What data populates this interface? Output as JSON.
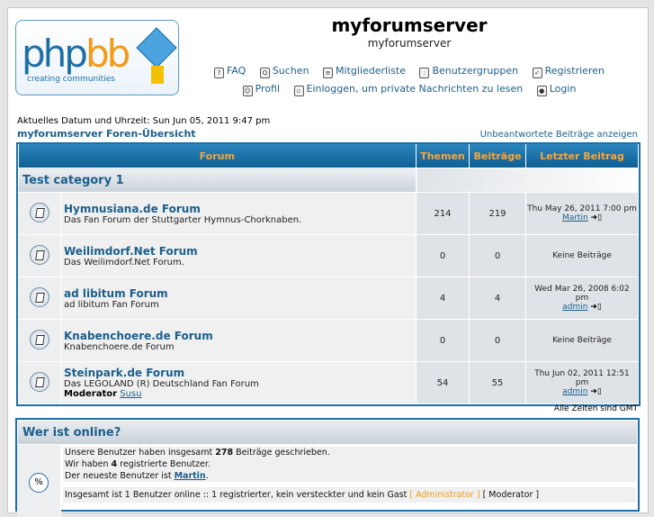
{
  "header": {
    "site_title": "myforumserver",
    "site_desc": "myforumserver",
    "logo_text": "phpbb creating communities"
  },
  "nav": {
    "row1": [
      {
        "label": "FAQ",
        "icon": "faq-icon"
      },
      {
        "label": "Suchen",
        "icon": "search-icon"
      },
      {
        "label": "Mitgliederliste",
        "icon": "memberlist-icon"
      },
      {
        "label": "Benutzergruppen",
        "icon": "groups-icon"
      },
      {
        "label": "Registrieren",
        "icon": "register-icon"
      }
    ],
    "row2": [
      {
        "label": "Profil",
        "icon": "profile-icon"
      },
      {
        "label": "Einloggen, um private Nachrichten zu lesen",
        "icon": "message-icon"
      },
      {
        "label": "Login",
        "icon": "login-icon"
      }
    ]
  },
  "date_line": "Aktuelles Datum und Uhrzeit: Sun Jun 05, 2011 9:47 pm",
  "breadcrumb": "myforumserver Foren-Übersicht",
  "unanswered_link": "Unbeantwortete Beiträge anzeigen",
  "table": {
    "headers": {
      "forum": "Forum",
      "topics": "Themen",
      "posts": "Beiträge",
      "last": "Letzter Beitrag"
    },
    "category": "Test category 1",
    "forums": [
      {
        "name": "Hymnusiana.de Forum",
        "desc": "Das Fan Forum der Stuttgarter Hymnus-Chorknaben.",
        "topics": "214",
        "posts": "219",
        "last_date": "Thu May 26, 2011 7:00 pm",
        "last_user": "Martin"
      },
      {
        "name": "Weilimdorf.Net Forum",
        "desc": "Das Weilimdorf.Net Forum.",
        "topics": "0",
        "posts": "0",
        "no_posts": "Keine Beiträge"
      },
      {
        "name": "ad libitum Forum",
        "desc": "ad libitum Fan Forum",
        "topics": "4",
        "posts": "4",
        "last_date": "Wed Mar 26, 2008 6:02 pm",
        "last_user": "admin"
      },
      {
        "name": "Knabenchoere.de Forum",
        "desc": "Knabenchoere.de Forum",
        "topics": "0",
        "posts": "0",
        "no_posts": "Keine Beiträge"
      },
      {
        "name": "Steinpark.de Forum",
        "desc": "Das LEGOLAND (R) Deutschland Fan Forum",
        "topics": "54",
        "posts": "55",
        "last_date": "Thu Jun 02, 2011 12:51 pm",
        "last_user": "admin",
        "moderator_label": "Moderator",
        "moderator": "Susu"
      }
    ]
  },
  "timezone": "Alle Zeiten sind GMT",
  "online": {
    "title": "Wer ist online?",
    "l1a": "Unsere Benutzer haben insgesamt ",
    "l1b": "278",
    "l1c": " Beiträge geschrieben.",
    "l2a": "Wir haben ",
    "l2b": "4",
    "l2c": " registrierte Benutzer.",
    "l3a": "Der neueste Benutzer ist ",
    "l3b": "Martin",
    "l3c": ".",
    "l4a": "Insgesamt ist 1 Benutzer online :: 1 registrierter, kein versteckter und kein Gast   ",
    "l4b": "[ Administrator ]",
    "l4c": "   [ Moderator ]"
  }
}
